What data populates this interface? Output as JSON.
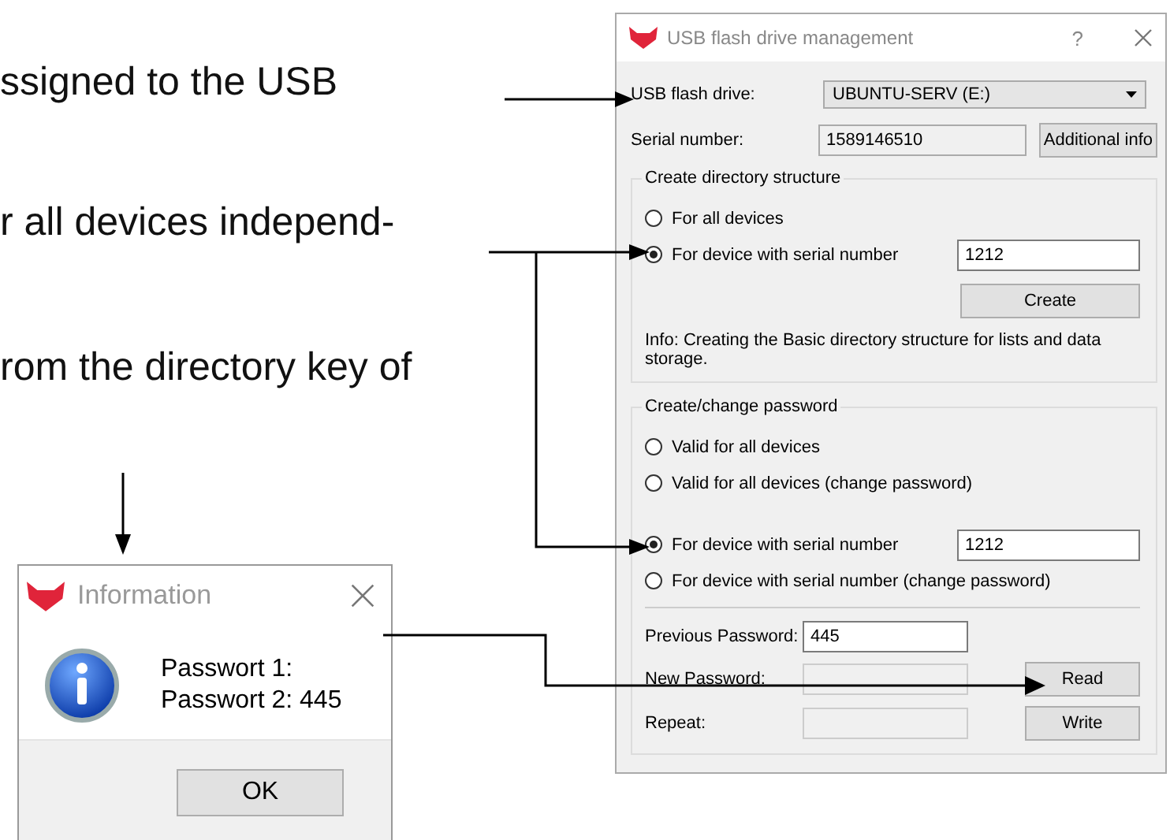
{
  "document_text": [
    "ssigned to the USB",
    "r all devices independ-",
    "rom the directory key of"
  ],
  "main_dialog": {
    "title": "USB flash drive management",
    "help": "?",
    "drive_label": "USB flash drive:",
    "drive_value": "UBUNTU-SERV (E:)",
    "serial_label": "Serial number:",
    "serial_value": "1589146510",
    "info_button": "Additional info",
    "directory_group": {
      "title": "Create directory structure",
      "options": [
        {
          "label": "For all devices",
          "selected": false
        },
        {
          "label": "For device with serial number",
          "selected": true,
          "value": "1212"
        }
      ],
      "button": "Create",
      "info": "Info: Creating the Basic directory structure for lists and data storage."
    },
    "password_group": {
      "title": "Create/change password",
      "options": [
        {
          "label": "Valid for all devices",
          "selected": false
        },
        {
          "label": "Valid for all devices (change password)",
          "selected": false
        },
        {
          "label": "For device with serial number",
          "selected": true,
          "value": "1212"
        },
        {
          "label": "For device with serial number (change password)",
          "selected": false
        }
      ],
      "fields": [
        {
          "label": "Previous Password:",
          "value": "445",
          "disabled": false
        },
        {
          "label": "New Password:",
          "disabled": true
        },
        {
          "label": "Repeat:",
          "disabled": true
        }
      ],
      "buttons": [
        "Read",
        "Write"
      ]
    }
  },
  "info_dialog": {
    "title": "Information",
    "lines": [
      "Passwort 1:",
      "Passwort 2: 445"
    ],
    "button": "OK"
  }
}
